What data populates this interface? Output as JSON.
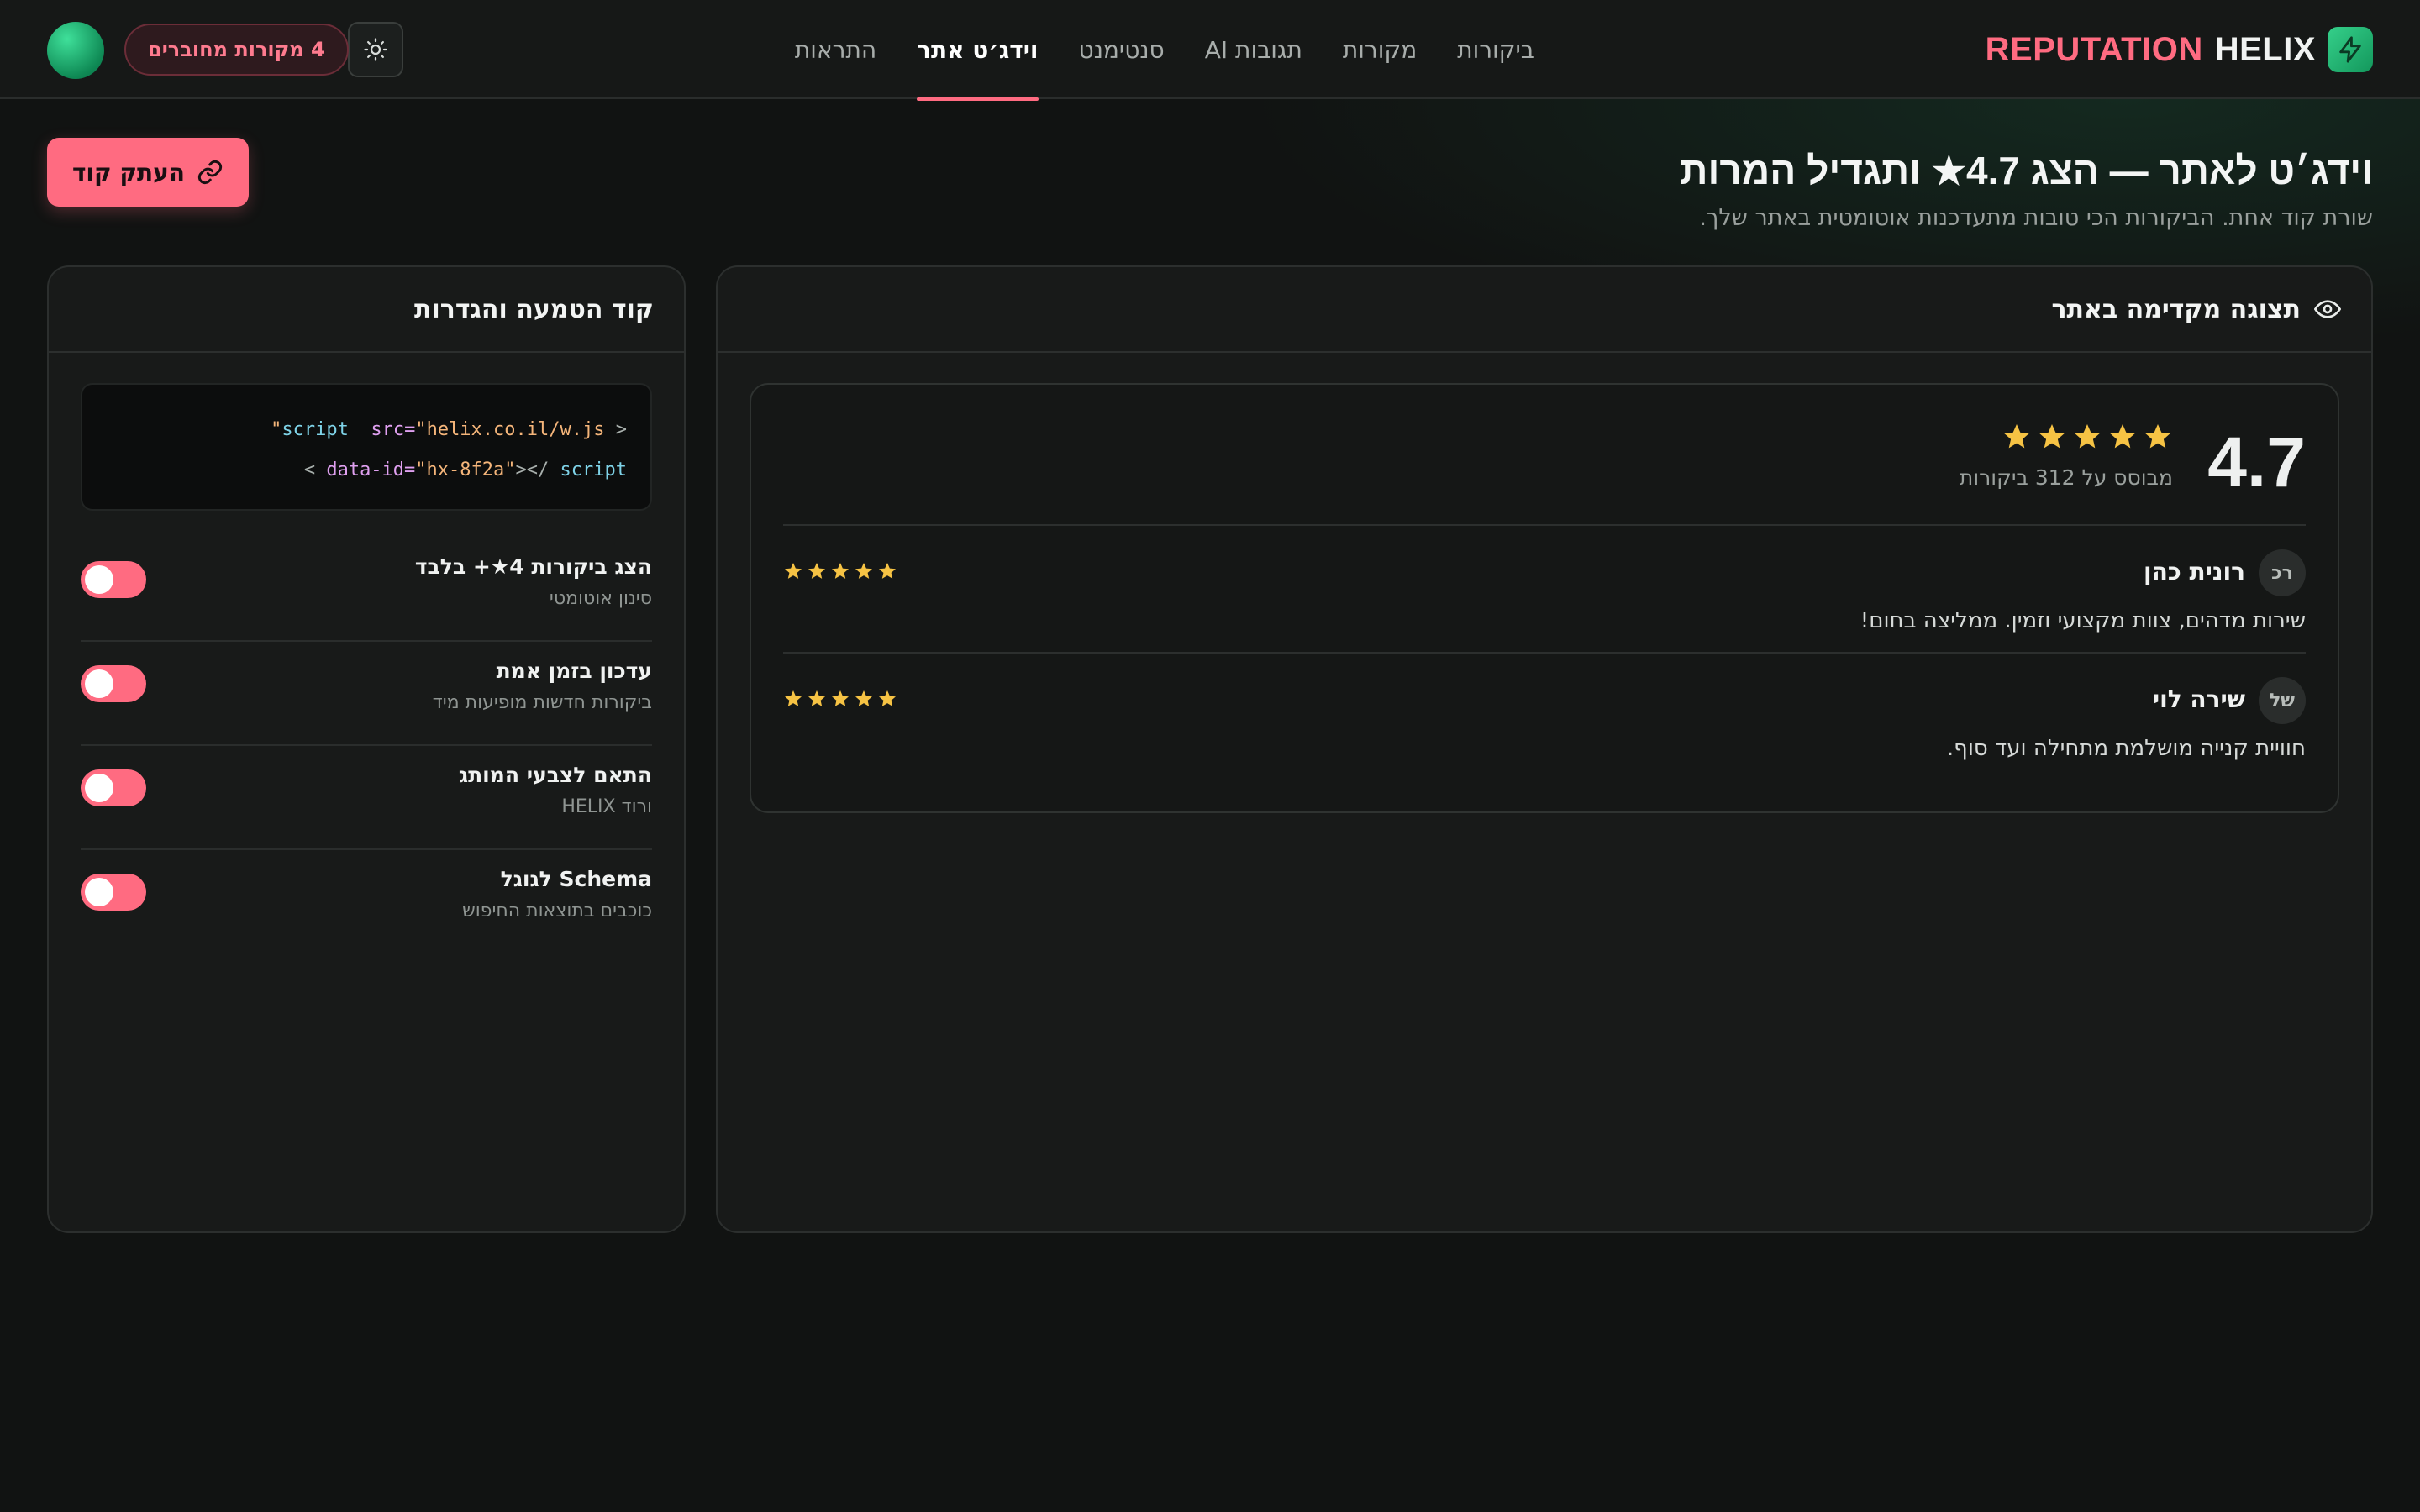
{
  "brand": {
    "word_a": "REPUTATION",
    "word_b": "HELIX",
    "icon": "bolt-icon",
    "accent": "#ff6b81",
    "green": "#1fbf76"
  },
  "nav": {
    "tabs": [
      {
        "label": "ביקורות",
        "active": false
      },
      {
        "label": "מקורות",
        "active": false
      },
      {
        "label": "תגובות AI",
        "active": false
      },
      {
        "label": "סנטימנט",
        "active": false
      },
      {
        "label": "וידג׳ט אתר",
        "active": true
      },
      {
        "label": "התראות",
        "active": false
      }
    ]
  },
  "header_actions": {
    "sources_label": "4 מקורות מחוברים",
    "theme_icon": "sun-icon"
  },
  "page": {
    "title": "וידג׳ט לאתר — הצג 4.7★ ותגדיל המרות",
    "subtitle": "שורת קוד אחת. הביקורות הכי טובות מתעדכנות אוטומטית באתר שלך.",
    "copy_button": "העתק קוד"
  },
  "preview": {
    "heading": "תצוגה מקדימה באתר",
    "rating": "4.7",
    "stars": 5,
    "based_on": "מבוסס על 312 ביקורות",
    "reviews": [
      {
        "initials": "רכ",
        "name": "רונית כהן",
        "stars": 5,
        "text": "שירות מדהים, צוות מקצועי וזמין. ממליצה בחום!"
      },
      {
        "initials": "של",
        "name": "שירה לוי",
        "stars": 5,
        "text": "חוויית קנייה מושלמת מתחילה ועד סוף."
      }
    ]
  },
  "settings": {
    "heading": "קוד הטמעה והגדרות",
    "code": {
      "line1": {
        "lt": "<",
        "tag": "script",
        "attr": "src=",
        "val": "\"helix.co.il/w.js\""
      },
      "line2": {
        "attr": "data-id=",
        "val": "\"hx-8f2a\"",
        "close": "></",
        "tag": "script",
        "end": ">"
      }
    },
    "toggles": [
      {
        "title": "הצג ביקורות 4★+ בלבד",
        "subtitle": "סינון אוטומטי",
        "on": true
      },
      {
        "title": "עדכון בזמן אמת",
        "subtitle": "ביקורות חדשות מופיעות מיד",
        "on": true
      },
      {
        "title": "התאם לצבעי המותג",
        "subtitle": "ורוד HELIX",
        "on": true
      },
      {
        "title": "Schema לגוגל",
        "subtitle": "כוכבים בתוצאות החיפוש",
        "on": true
      }
    ]
  }
}
